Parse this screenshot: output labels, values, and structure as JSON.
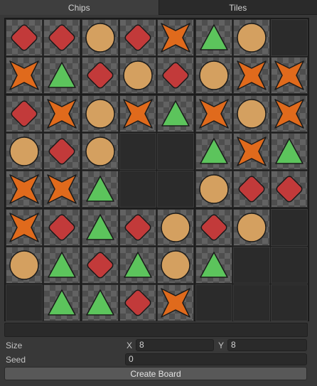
{
  "tabs": [
    {
      "label": "Chips",
      "active": true
    },
    {
      "label": "Tiles",
      "active": false
    }
  ],
  "board": {
    "columns": 8,
    "rows": 8,
    "cells": [
      [
        "diamond",
        "diamond",
        "circle",
        "diamond",
        "star",
        "triangle",
        "circle",
        "none"
      ],
      [
        "star",
        "triangle",
        "diamond",
        "circle",
        "diamond",
        "circle",
        "star",
        "star"
      ],
      [
        "diamond",
        "star",
        "circle",
        "star",
        "triangle",
        "star",
        "circle",
        "star"
      ],
      [
        "circle",
        "diamond",
        "circle",
        "empty",
        "empty",
        "triangle",
        "star",
        "triangle"
      ],
      [
        "star",
        "star",
        "triangle",
        "empty",
        "empty",
        "circle",
        "diamond",
        "diamond"
      ],
      [
        "star",
        "diamond",
        "triangle",
        "diamond",
        "circle",
        "diamond",
        "circle",
        "none"
      ],
      [
        "circle",
        "triangle",
        "diamond",
        "triangle",
        "circle",
        "triangle",
        "none",
        "none"
      ],
      [
        "none",
        "triangle",
        "triangle",
        "diamond",
        "star",
        "none",
        "none",
        "none"
      ]
    ],
    "colors": {
      "diamond": "#c23a3a",
      "circle": "#d4a060",
      "star": "#e06a1c",
      "triangle": "#5cc45c",
      "outline": "#1a1a1a"
    }
  },
  "form": {
    "size_label": "Size",
    "x_label": "X",
    "x_value": "8",
    "y_label": "Y",
    "y_value": "8",
    "seed_label": "Seed",
    "seed_value": "0",
    "create_button": "Create Board"
  }
}
